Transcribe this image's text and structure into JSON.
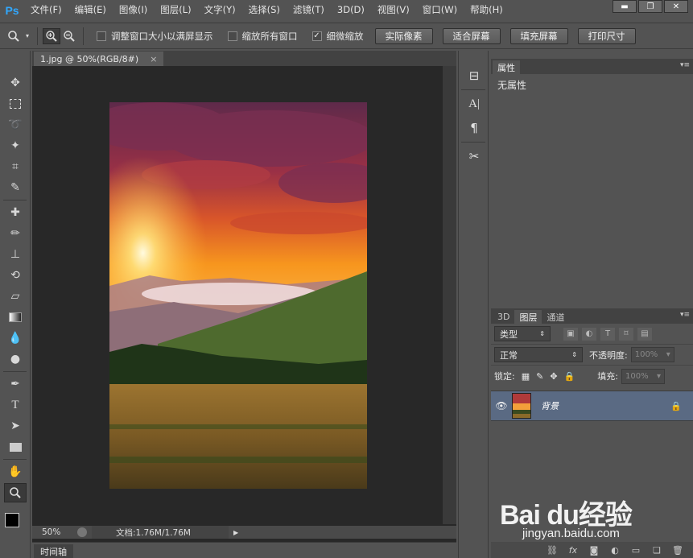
{
  "app": {
    "logo": "Ps"
  },
  "menu": [
    "文件(F)",
    "编辑(E)",
    "图像(I)",
    "图层(L)",
    "文字(Y)",
    "选择(S)",
    "滤镜(T)",
    "3D(D)",
    "视图(V)",
    "窗口(W)",
    "帮助(H)"
  ],
  "window_controls": {
    "minimize": "▬",
    "restore": "❐",
    "close": "✕"
  },
  "options": {
    "check_resize_window": "调整窗口大小以满屏显示",
    "check_zoom_all": "缩放所有窗口",
    "check_scrubby": "细微缩放",
    "btn_actual_pixels": "实际像素",
    "btn_fit_screen": "适合屏幕",
    "btn_fill_screen": "填充屏幕",
    "btn_print_size": "打印尺寸",
    "checked": {
      "resize_window": false,
      "zoom_all": false,
      "scrubby": true
    }
  },
  "document": {
    "tab_title": "1.jpg @ 50%(RGB/8#)",
    "tab_close": "×",
    "zoom": "50%",
    "doc_info": "文档:1.76M/1.76M",
    "timeline_tab": "时间轴"
  },
  "properties_panel": {
    "tab": "属性",
    "body": "无属性"
  },
  "layers_panel": {
    "tabs": [
      "3D",
      "图层",
      "通道"
    ],
    "active_tab": "图层",
    "filter_kind": "类型",
    "blend_mode": "正常",
    "opacity_label": "不透明度:",
    "opacity_value": "100%",
    "lock_label": "锁定:",
    "fill_label": "填充:",
    "fill_value": "100%",
    "layers": [
      {
        "name": "背景",
        "visible": true,
        "locked": true
      }
    ]
  },
  "watermark": {
    "brand": "Bai du经验",
    "url": "jingyan.baidu.com"
  },
  "colors": {
    "panel": "#535353",
    "dark": "#282828",
    "selection": "#5a6a83",
    "ps_blue": "#31a8ff"
  }
}
